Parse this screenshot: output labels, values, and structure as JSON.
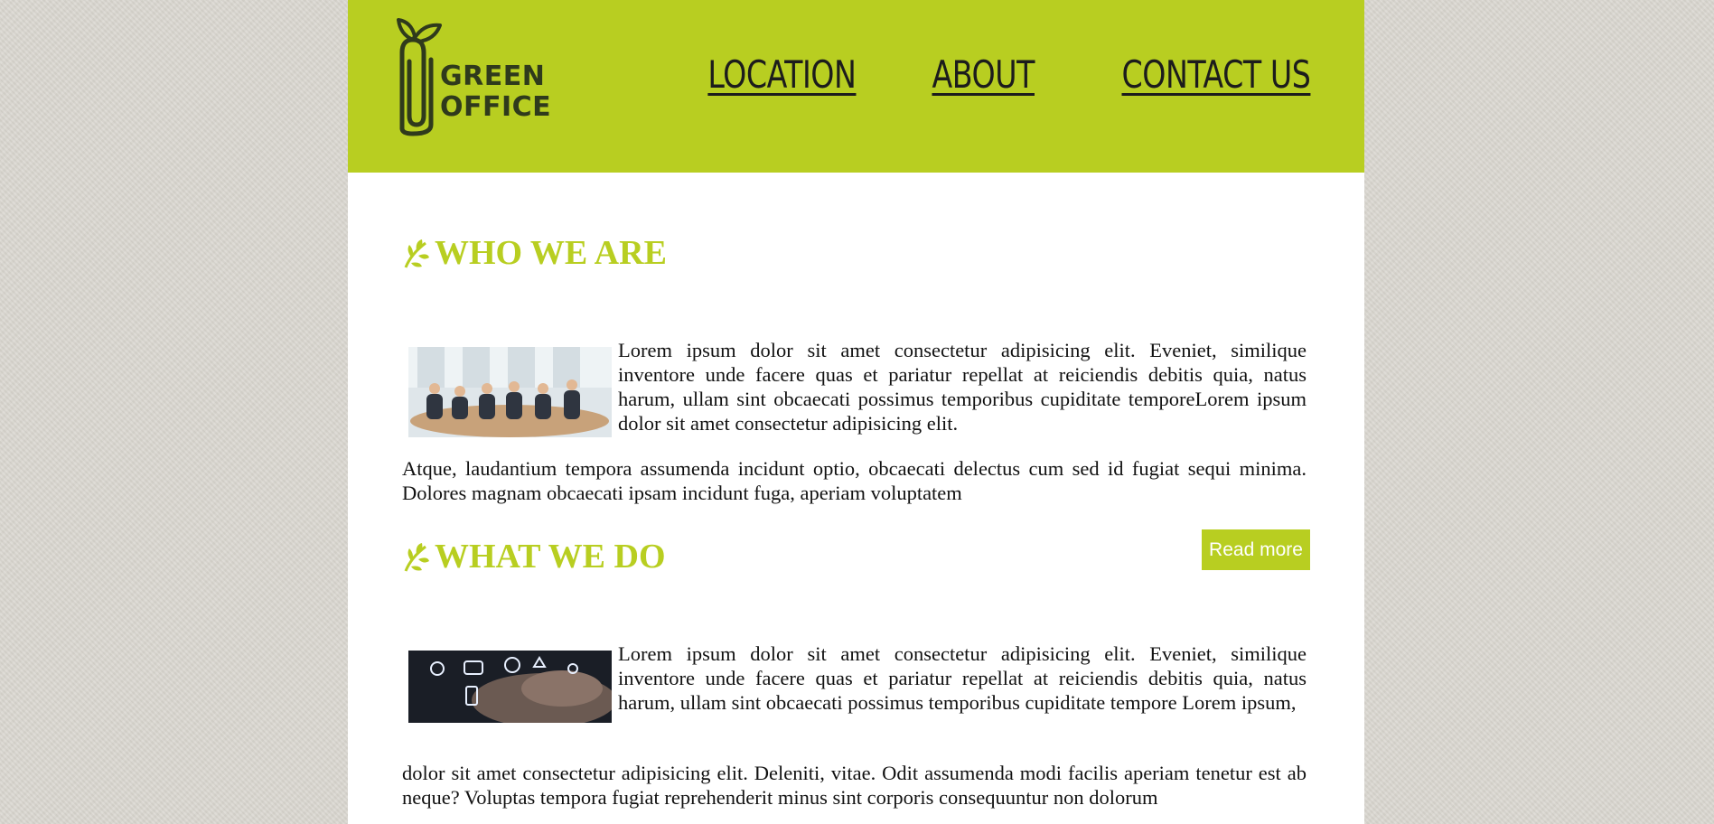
{
  "colors": {
    "accent": "#b8ce21",
    "text": "#111111",
    "nav_text": "#1c1c1c"
  },
  "logo": {
    "line1": "GREEN",
    "line2": "OFFICE",
    "icon": "paperclip-sprout-icon"
  },
  "nav": {
    "items": [
      {
        "label": "LOCATION"
      },
      {
        "label": "ABOUT"
      },
      {
        "label": "CONTACT US"
      }
    ]
  },
  "sections": [
    {
      "title": "WHO WE ARE",
      "icon": "leaf-icon",
      "image": "team-meeting-photo",
      "paragraph1": "Lorem ipsum dolor sit amet consectetur adipisicing elit. Eveniet, similique inventore unde facere quas et pariatur repellat at reiciendis debitis quia, natus harum, ullam sint obcaecati possimus temporibus cupiditate temporeLorem ipsum dolor sit amet consectetur adipisicing elit.",
      "paragraph2": "Atque, laudantium tempora assumenda incidunt optio, obcaecati delectus cum sed id fugiat sequi minima. Dolores magnam obcaecati ipsam incidunt fuga, aperiam voluptatem",
      "button": "Read more"
    },
    {
      "title": "WHAT WE DO",
      "icon": "leaf-icon",
      "image": "touch-technology-photo",
      "paragraph1": "Lorem ipsum dolor sit amet consectetur adipisicing elit. Eveniet, similique inventore unde facere quas et pariatur repellat at reiciendis debitis quia, natus harum, ullam sint obcaecati possimus temporibus cupiditate tempore Lorem ipsum,",
      "paragraph2": "dolor sit amet consectetur adipisicing elit. Deleniti, vitae. Odit assumenda modi facilis aperiam tenetur est ab neque? Voluptas tempora fugiat reprehenderit minus sint corporis consequuntur non dolorum"
    }
  ]
}
